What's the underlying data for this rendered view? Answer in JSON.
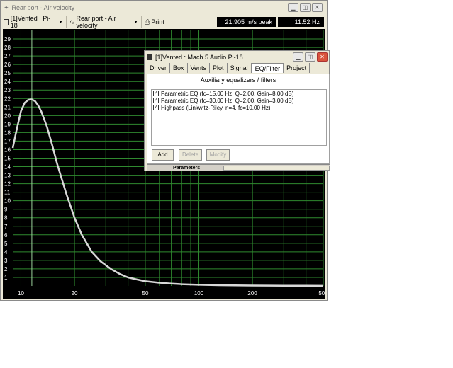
{
  "window": {
    "title": "Rear port - Air velocity",
    "caption_buttons": [
      "minimize",
      "restore",
      "close"
    ]
  },
  "toolbar": {
    "project_select": "[1]Vented : Pi-18",
    "graph_select": "Rear port - Air velocity",
    "print_label": "Print",
    "peak_readout": "21.905 m/s peak",
    "freq_readout": "11.52 Hz"
  },
  "chart_data": {
    "type": "line",
    "title": "",
    "xlabel": "",
    "ylabel": "",
    "x_scale": "log",
    "xlim": [
      9,
      500
    ],
    "ylim": [
      0,
      30
    ],
    "x_ticks": [
      10,
      20,
      50,
      100,
      200,
      500
    ],
    "x_tick_labels": [
      "10",
      "20",
      "50",
      "100",
      "200",
      "500"
    ],
    "y_ticks": [
      1,
      2,
      3,
      4,
      5,
      6,
      7,
      8,
      9,
      10,
      11,
      12,
      13,
      14,
      15,
      16,
      17,
      18,
      19,
      20,
      21,
      22,
      23,
      24,
      25,
      26,
      27,
      28,
      29
    ],
    "grid": true,
    "cursor_x": 11.52,
    "series": [
      {
        "name": "",
        "color": "#d8d8d8",
        "x": [
          9,
          9.5,
          10,
          10.5,
          11,
          11.5,
          12,
          12.5,
          13,
          14,
          15,
          16,
          18,
          20,
          22,
          25,
          28,
          32,
          36,
          40,
          45,
          50,
          60,
          70,
          80,
          100,
          130,
          160,
          200,
          300,
          400,
          500
        ],
        "y": [
          16.2,
          18.5,
          20.5,
          21.5,
          21.85,
          21.9,
          21.7,
          21.2,
          20.5,
          18.7,
          16.5,
          14.3,
          10.8,
          8.0,
          6.0,
          4.0,
          2.9,
          2.0,
          1.4,
          1.0,
          0.75,
          0.55,
          0.37,
          0.27,
          0.2,
          0.13,
          0.08,
          0.06,
          0.04,
          0.02,
          0.015,
          0.01
        ]
      }
    ]
  },
  "dialog": {
    "title": "[1]Vented : Mach 5 Audio Pi-18",
    "tabs": [
      "Driver",
      "Box",
      "Vents",
      "Plot",
      "Signal",
      "EQ/Filter",
      "Project"
    ],
    "active_tab": "EQ/Filter",
    "section_header": "Auxiliary equalizers / filters",
    "filters": [
      {
        "checked": true,
        "label": "Parametric EQ (fc=15.00 Hz, Q=2.00, Gain=8.00 dB)"
      },
      {
        "checked": true,
        "label": "Parametric EQ (fc=30.00 Hz, Q=2.00, Gain=3.00 dB)"
      },
      {
        "checked": true,
        "label": "Highpass (Linkwitz-Riley, n=4, fc=10.00 Hz)"
      }
    ],
    "buttons": {
      "add": "Add",
      "delete": "Delete",
      "modify": "Modify"
    },
    "params_label": "Parameters"
  }
}
